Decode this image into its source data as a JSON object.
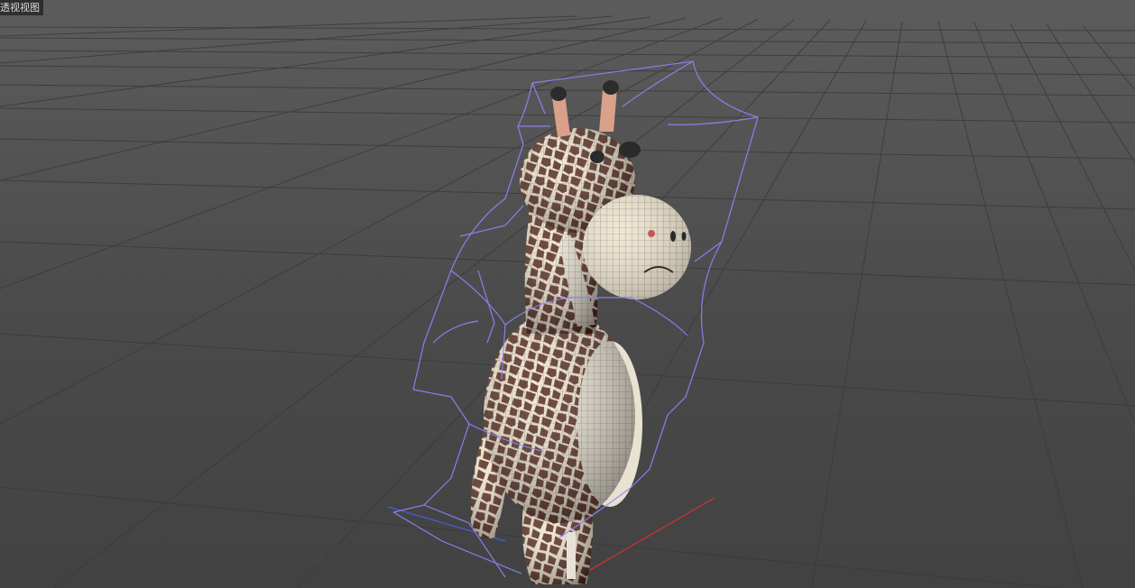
{
  "viewport": {
    "label": "透视视图",
    "background": "#4d4d4d"
  },
  "scene": {
    "object": "giraffe-model",
    "grid_color": "#3c3c3c",
    "deformer_cage_color": "#8f86ff",
    "axis_x_color": "#e03030",
    "axis_z_color": "#4060e0"
  }
}
